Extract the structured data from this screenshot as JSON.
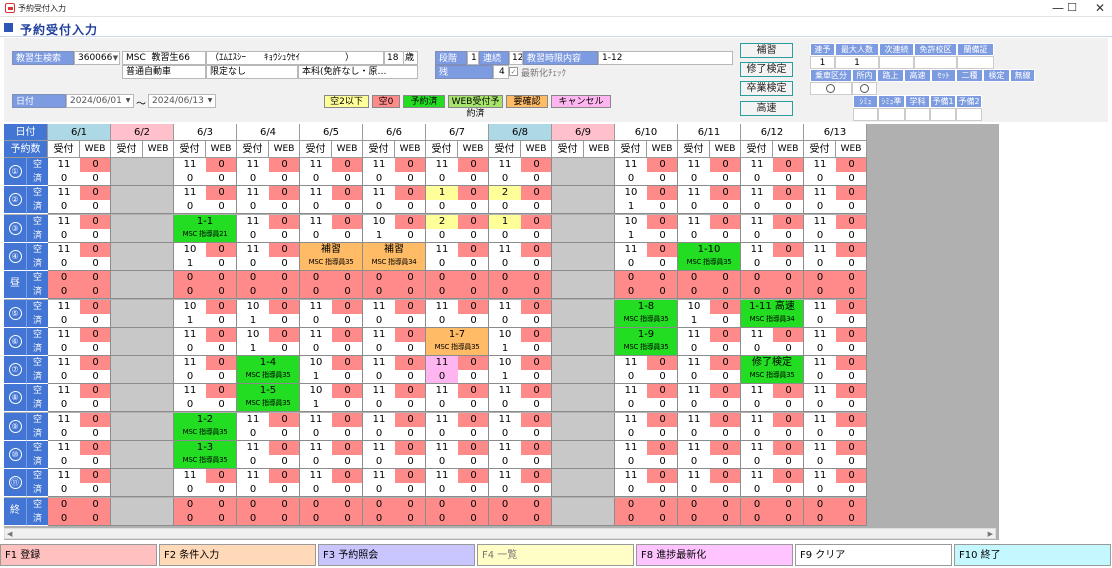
{
  "window": {
    "title": "予約受付入力",
    "minimize": "—",
    "maximize": "☐",
    "close": "✕"
  },
  "header": {
    "title": "予約受付入力"
  },
  "student": {
    "label": "教習生検索",
    "id": "360066",
    "school": "MSC",
    "name": "教習生66",
    "kana": "（ｴﾑｴｽｼｰ　　ｷｮｳｼｭｳｾｲ　　　　　）",
    "age": "18",
    "age_unit": "歳",
    "license": "普通自動車",
    "condition": "限定なし",
    "course": "本科(免許なし・原…"
  },
  "stage": {
    "label": "段階",
    "value": "1",
    "period_label": "連続",
    "period": "12",
    "time_label": "教習時限内容",
    "time": "1-12",
    "remain_label": "残",
    "remain": "4",
    "refresh_label": "最新化ﾁｪｯｸ"
  },
  "date_range": {
    "label": "日付",
    "from": "2024/06/01",
    "to": "2024/06/13",
    "sep": "～"
  },
  "legend": [
    {
      "label": "空2以下",
      "bg": "#ffff99"
    },
    {
      "label": "空0",
      "bg": "#ff8a8a"
    },
    {
      "label": "予約済",
      "bg": "#22dd22"
    },
    {
      "label": "WEB受付予約済",
      "bg": "#a6e36b"
    },
    {
      "label": "要確認",
      "bg": "#ffbb66"
    },
    {
      "label": "キャンセル",
      "bg": "#ffb6f0"
    }
  ],
  "side_buttons": [
    "補習",
    "修了検定",
    "卒業検定",
    "高速"
  ],
  "right_table": {
    "row1_labels": [
      "連予",
      "最大人数",
      "次連続",
      "免許校区",
      "蘭備証"
    ],
    "row1_values": [
      "1",
      "1",
      "",
      "",
      ""
    ],
    "row2_labels": [
      "乗車区分",
      "所内",
      "路上",
      "高速",
      "ｾｯﾄ",
      "二種",
      "検定",
      "無線"
    ],
    "row3_labels": [
      "ｼﾐｭ",
      "ｼﾐｭ準",
      "学科",
      "予備1",
      "予備2"
    ]
  },
  "grid": {
    "header": {
      "day": "日付",
      "count": "予約数",
      "uketsuke": "受付",
      "web": "WEB",
      "ku": "空",
      "sumi": "済"
    },
    "dates": [
      "6/1",
      "6/2",
      "6/3",
      "6/4",
      "6/5",
      "6/6",
      "6/7",
      "6/8",
      "6/9",
      "6/10",
      "6/11",
      "6/12",
      "6/13"
    ],
    "slots": [
      "①",
      "②",
      "③",
      "④",
      "昼",
      "⑤",
      "⑥",
      "⑦",
      "⑧",
      "⑨",
      "⑩",
      "⑪",
      "終"
    ],
    "cells": [
      [
        [
          "11",
          "0",
          "0",
          "0"
        ],
        "X",
        [
          "11",
          "0",
          "0",
          "0"
        ],
        [
          "11",
          "0",
          "0",
          "0"
        ],
        [
          "11",
          "0",
          "0",
          "0"
        ],
        [
          "11",
          "0",
          "0",
          "0"
        ],
        [
          "11",
          "0",
          "0",
          "0"
        ],
        [
          "11",
          "0",
          "0",
          "0"
        ],
        "X",
        [
          "11",
          "0",
          "0",
          "0"
        ],
        [
          "11",
          "0",
          "0",
          "0"
        ],
        [
          "11",
          "0",
          "0",
          "0"
        ],
        [
          "11",
          "0",
          "0",
          "0"
        ]
      ],
      [
        [
          "11",
          "0",
          "0",
          "0"
        ],
        "X",
        [
          "11",
          "0",
          "0",
          "0"
        ],
        [
          "11",
          "0",
          "0",
          "0"
        ],
        [
          "11",
          "0",
          "0",
          "0"
        ],
        [
          "11",
          "0",
          "0",
          "0"
        ],
        [
          "1",
          "0",
          "0",
          "0"
        ],
        [
          "2",
          "0",
          "0",
          "0"
        ],
        "X",
        [
          "10",
          "0",
          "1",
          "0"
        ],
        [
          "11",
          "0",
          "0",
          "0"
        ],
        [
          "11",
          "0",
          "0",
          "0"
        ],
        [
          "11",
          "0",
          "0",
          "0"
        ]
      ],
      [
        [
          "11",
          "0",
          "0",
          "0"
        ],
        "X",
        {
          "t": "1-1",
          "s": "MSC 指導員21",
          "c": "g"
        },
        [
          "11",
          "0",
          "0",
          "0"
        ],
        [
          "11",
          "0",
          "0",
          "0"
        ],
        [
          "10",
          "0",
          "1",
          "0"
        ],
        [
          "2",
          "0",
          "0",
          "0"
        ],
        [
          "1",
          "0",
          "0",
          "0"
        ],
        "X",
        [
          "10",
          "0",
          "1",
          "0"
        ],
        [
          "11",
          "0",
          "0",
          "0"
        ],
        [
          "11",
          "0",
          "0",
          "0"
        ],
        [
          "11",
          "0",
          "0",
          "0"
        ]
      ],
      [
        [
          "11",
          "0",
          "0",
          "0"
        ],
        "X",
        [
          "10",
          "0",
          "1",
          "0"
        ],
        [
          "11",
          "0",
          "0",
          "0"
        ],
        {
          "t": "補習",
          "s": "MSC 指導員35",
          "c": "o"
        },
        {
          "t": "補習",
          "s": "MSC 指導員34",
          "c": "o"
        },
        [
          "11",
          "0",
          "0",
          "0"
        ],
        [
          "11",
          "0",
          "0",
          "0"
        ],
        "X",
        [
          "11",
          "0",
          "0",
          "0"
        ],
        {
          "t": "1-10",
          "s": "MSC 指導員35",
          "c": "g"
        },
        [
          "11",
          "0",
          "0",
          "0"
        ],
        [
          "11",
          "0",
          "0",
          "0"
        ]
      ],
      [
        [
          "0",
          "0",
          "0",
          "0"
        ],
        "X",
        [
          "0",
          "0",
          "0",
          "0"
        ],
        [
          "0",
          "0",
          "0",
          "0"
        ],
        [
          "0",
          "0",
          "0",
          "0"
        ],
        [
          "0",
          "0",
          "0",
          "0"
        ],
        [
          "0",
          "0",
          "0",
          "0"
        ],
        [
          "0",
          "0",
          "0",
          "0"
        ],
        "X",
        [
          "0",
          "0",
          "0",
          "0"
        ],
        [
          "0",
          "0",
          "0",
          "0"
        ],
        [
          "0",
          "0",
          "0",
          "0"
        ],
        [
          "0",
          "0",
          "0",
          "0"
        ]
      ],
      [
        [
          "11",
          "0",
          "0",
          "0"
        ],
        "X",
        [
          "10",
          "0",
          "1",
          "0"
        ],
        [
          "10",
          "0",
          "1",
          "0"
        ],
        [
          "11",
          "0",
          "0",
          "0"
        ],
        [
          "11",
          "0",
          "0",
          "0"
        ],
        [
          "11",
          "0",
          "0",
          "0"
        ],
        [
          "11",
          "0",
          "0",
          "0"
        ],
        "X",
        {
          "t": "1-8",
          "s": "MSC 指導員35",
          "c": "g"
        },
        [
          "10",
          "0",
          "1",
          "0"
        ],
        {
          "t": "1-11 高速",
          "s": "MSC 指導員34",
          "c": "g"
        },
        [
          "11",
          "0",
          "0",
          "0"
        ]
      ],
      [
        [
          "11",
          "0",
          "0",
          "0"
        ],
        "X",
        [
          "11",
          "0",
          "0",
          "0"
        ],
        [
          "10",
          "0",
          "1",
          "0"
        ],
        [
          "11",
          "0",
          "0",
          "0"
        ],
        [
          "11",
          "0",
          "0",
          "0"
        ],
        {
          "t": "1-7",
          "s": "MSC 指導員35",
          "c": "o"
        },
        [
          "10",
          "0",
          "1",
          "0"
        ],
        "X",
        {
          "t": "1-9",
          "s": "MSC 指導員35",
          "c": "g"
        },
        [
          "11",
          "0",
          "0",
          "0"
        ],
        [
          "11",
          "0",
          "0",
          "0"
        ],
        [
          "11",
          "0",
          "0",
          "0"
        ]
      ],
      [
        [
          "11",
          "0",
          "0",
          "0"
        ],
        "X",
        [
          "11",
          "0",
          "0",
          "0"
        ],
        {
          "t": "1-4",
          "s": "MSC 指導員35",
          "c": "g"
        },
        [
          "10",
          "0",
          "1",
          "0"
        ],
        [
          "11",
          "0",
          "0",
          "0"
        ],
        {
          "t": "11",
          "s": "0",
          "c": "p",
          "p": [
            "11",
            "0",
            "0",
            "0"
          ]
        },
        [
          "10",
          "0",
          "1",
          "0"
        ],
        "X",
        [
          "11",
          "0",
          "0",
          "0"
        ],
        [
          "11",
          "0",
          "0",
          "0"
        ],
        {
          "t": "修了検定",
          "s": "MSC 指導員35",
          "c": "g"
        },
        [
          "11",
          "0",
          "0",
          "0"
        ]
      ],
      [
        [
          "11",
          "0",
          "0",
          "0"
        ],
        "X",
        [
          "11",
          "0",
          "0",
          "0"
        ],
        {
          "t": "1-5",
          "s": "MSC 指導員35",
          "c": "g"
        },
        [
          "10",
          "0",
          "1",
          "0"
        ],
        [
          "11",
          "0",
          "0",
          "0"
        ],
        [
          "11",
          "0",
          "0",
          "0"
        ],
        [
          "11",
          "0",
          "0",
          "0"
        ],
        "X",
        [
          "11",
          "0",
          "0",
          "0"
        ],
        [
          "11",
          "0",
          "0",
          "0"
        ],
        [
          "11",
          "0",
          "0",
          "0"
        ],
        [
          "11",
          "0",
          "0",
          "0"
        ]
      ],
      [
        [
          "11",
          "0",
          "0",
          "0"
        ],
        "X",
        {
          "t": "1-2",
          "s": "MSC 指導員35",
          "c": "g"
        },
        [
          "11",
          "0",
          "0",
          "0"
        ],
        [
          "11",
          "0",
          "0",
          "0"
        ],
        [
          "11",
          "0",
          "0",
          "0"
        ],
        [
          "11",
          "0",
          "0",
          "0"
        ],
        [
          "11",
          "0",
          "0",
          "0"
        ],
        "X",
        [
          "11",
          "0",
          "0",
          "0"
        ],
        [
          "11",
          "0",
          "0",
          "0"
        ],
        [
          "11",
          "0",
          "0",
          "0"
        ],
        [
          "11",
          "0",
          "0",
          "0"
        ]
      ],
      [
        [
          "11",
          "0",
          "0",
          "0"
        ],
        "X",
        {
          "t": "1-3",
          "s": "MSC 指導員35",
          "c": "g"
        },
        [
          "11",
          "0",
          "0",
          "0"
        ],
        [
          "11",
          "0",
          "0",
          "0"
        ],
        [
          "11",
          "0",
          "0",
          "0"
        ],
        [
          "11",
          "0",
          "0",
          "0"
        ],
        [
          "11",
          "0",
          "0",
          "0"
        ],
        "X",
        [
          "11",
          "0",
          "0",
          "0"
        ],
        [
          "11",
          "0",
          "0",
          "0"
        ],
        [
          "11",
          "0",
          "0",
          "0"
        ],
        [
          "11",
          "0",
          "0",
          "0"
        ]
      ],
      [
        [
          "11",
          "0",
          "0",
          "0"
        ],
        "X",
        [
          "11",
          "0",
          "0",
          "0"
        ],
        [
          "11",
          "0",
          "0",
          "0"
        ],
        [
          "11",
          "0",
          "0",
          "0"
        ],
        [
          "11",
          "0",
          "0",
          "0"
        ],
        [
          "11",
          "0",
          "0",
          "0"
        ],
        [
          "11",
          "0",
          "0",
          "0"
        ],
        "X",
        [
          "11",
          "0",
          "0",
          "0"
        ],
        [
          "11",
          "0",
          "0",
          "0"
        ],
        [
          "11",
          "0",
          "0",
          "0"
        ],
        [
          "11",
          "0",
          "0",
          "0"
        ]
      ],
      [
        [
          "0",
          "0",
          "0",
          "0"
        ],
        "X",
        [
          "0",
          "0",
          "0",
          "0"
        ],
        [
          "0",
          "0",
          "0",
          "0"
        ],
        [
          "0",
          "0",
          "0",
          "0"
        ],
        [
          "0",
          "0",
          "0",
          "0"
        ],
        [
          "0",
          "0",
          "0",
          "0"
        ],
        [
          "0",
          "0",
          "0",
          "0"
        ],
        "X",
        [
          "0",
          "0",
          "0",
          "0"
        ],
        [
          "0",
          "0",
          "0",
          "0"
        ],
        [
          "0",
          "0",
          "0",
          "0"
        ],
        [
          "0",
          "0",
          "0",
          "0"
        ]
      ]
    ]
  },
  "fkeys": [
    {
      "label": "F1 登録",
      "bg": "#ffc0c0"
    },
    {
      "label": "F2 条件入力",
      "bg": "#ffd9b8"
    },
    {
      "label": "F3 予約照会",
      "bg": "#c9c6ff"
    },
    {
      "label": "F4 一覧",
      "bg": "#fffec6"
    },
    {
      "label": "F8 進捗最新化",
      "bg": "#ffc4ff"
    },
    {
      "label": "F9 クリア",
      "bg": "#ffffff"
    },
    {
      "label": "F10 終了",
      "bg": "#c5f7ff"
    }
  ]
}
